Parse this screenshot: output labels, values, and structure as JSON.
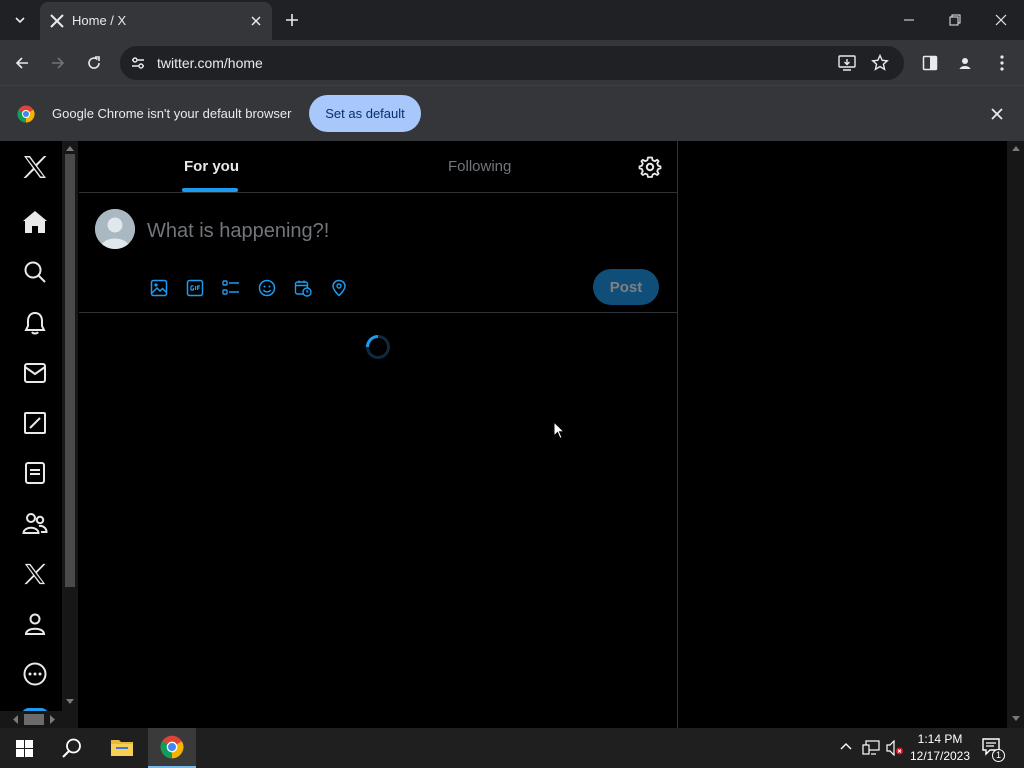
{
  "browser": {
    "tab_title": "Home / X",
    "url": "twitter.com/home",
    "infobar": {
      "message": "Google Chrome isn't your default browser",
      "button_label": "Set as default"
    }
  },
  "x": {
    "nav": [
      "x-logo-icon",
      "home-icon",
      "search-icon",
      "notifications-icon",
      "messages-icon",
      "grok-icon",
      "lists-icon",
      "communities-icon",
      "premium-icon",
      "profile-icon",
      "more-icon"
    ],
    "tabs": [
      {
        "label": "For you",
        "active": true
      },
      {
        "label": "Following",
        "active": false
      }
    ],
    "composer": {
      "placeholder": "What is happening?!",
      "post_label": "Post"
    }
  },
  "taskbar": {
    "time": "1:14 PM",
    "date": "12/17/2023",
    "notification_count": "1"
  },
  "colors": {
    "accent": "#1d9bf0",
    "chrome_bg": "#202124",
    "chrome_toolbar": "#35363a"
  }
}
